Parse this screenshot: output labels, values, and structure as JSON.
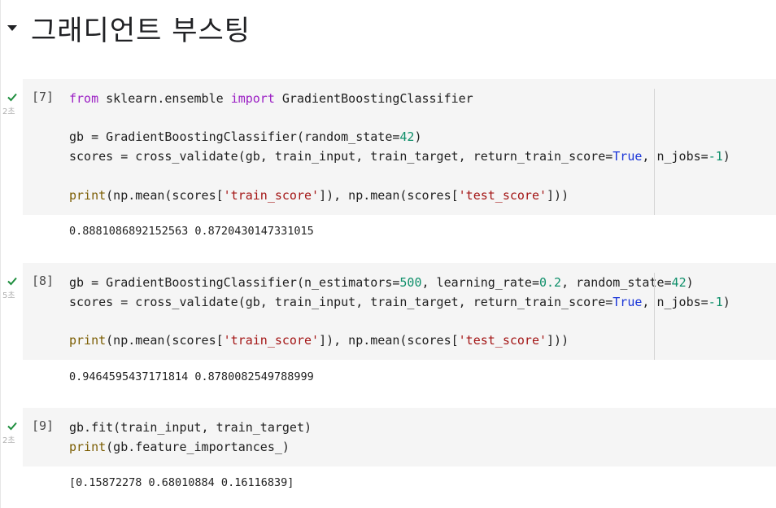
{
  "section": {
    "title": "그래디언트 부스팅"
  },
  "cells": [
    {
      "exec": "[7]",
      "duration": "2초",
      "lines": {
        "l1": {
          "kw1": "from",
          "mid": " sklearn.ensemble ",
          "kw2": "import",
          "tail": " GradientBoostingClassifier"
        },
        "l2": {
          "head": "gb = GradientBoostingClassifier(random_state=",
          "num": "42",
          "tail": ")"
        },
        "l3": {
          "head": "scores = cross_validate(gb, train_input, train_target, return_train_score=",
          "bool": "True",
          "mid": ", n_jobs=",
          "num": "-1",
          "tail": ")"
        },
        "l4": {
          "fn": "print",
          "a": "(np.mean(scores[",
          "s1": "'train_score'",
          "b": "]), np.mean(scores[",
          "s2": "'test_score'",
          "c": "]))"
        }
      },
      "output": "0.8881086892152563 0.8720430147331015"
    },
    {
      "exec": "[8]",
      "duration": "5초",
      "lines": {
        "l1": {
          "head": "gb = GradientBoostingClassifier(n_estimators=",
          "n1": "500",
          "mid": ", learning_rate=",
          "n2": "0.2",
          "mid2": ", random_state=",
          "n3": "42",
          "tail": ")"
        },
        "l2": {
          "head": "scores = cross_validate(gb, train_input, train_target, return_train_score=",
          "bool": "True",
          "mid": ", n_jobs=",
          "num": "-1",
          "tail": ")"
        },
        "l3": {
          "fn": "print",
          "a": "(np.mean(scores[",
          "s1": "'train_score'",
          "b": "]), np.mean(scores[",
          "s2": "'test_score'",
          "c": "]))"
        }
      },
      "output": "0.9464595437171814 0.8780082549788999"
    },
    {
      "exec": "[9]",
      "duration": "2초",
      "lines": {
        "l1": {
          "text": "gb.fit(train_input, train_target)"
        },
        "l2": {
          "fn": "print",
          "tail": "(gb.feature_importances_)"
        }
      },
      "output": "[0.15872278 0.68010884 0.16116839]"
    }
  ],
  "colors": {
    "check": "#1e8e3e",
    "keyword": "#9b1fc4",
    "number": "#0f8f6a",
    "string": "#a31515",
    "builtin": "#1a35d8",
    "cell_bg": "#f5f5f5"
  },
  "icons": {
    "collapse": "caret-down-icon",
    "status": "check-icon"
  }
}
